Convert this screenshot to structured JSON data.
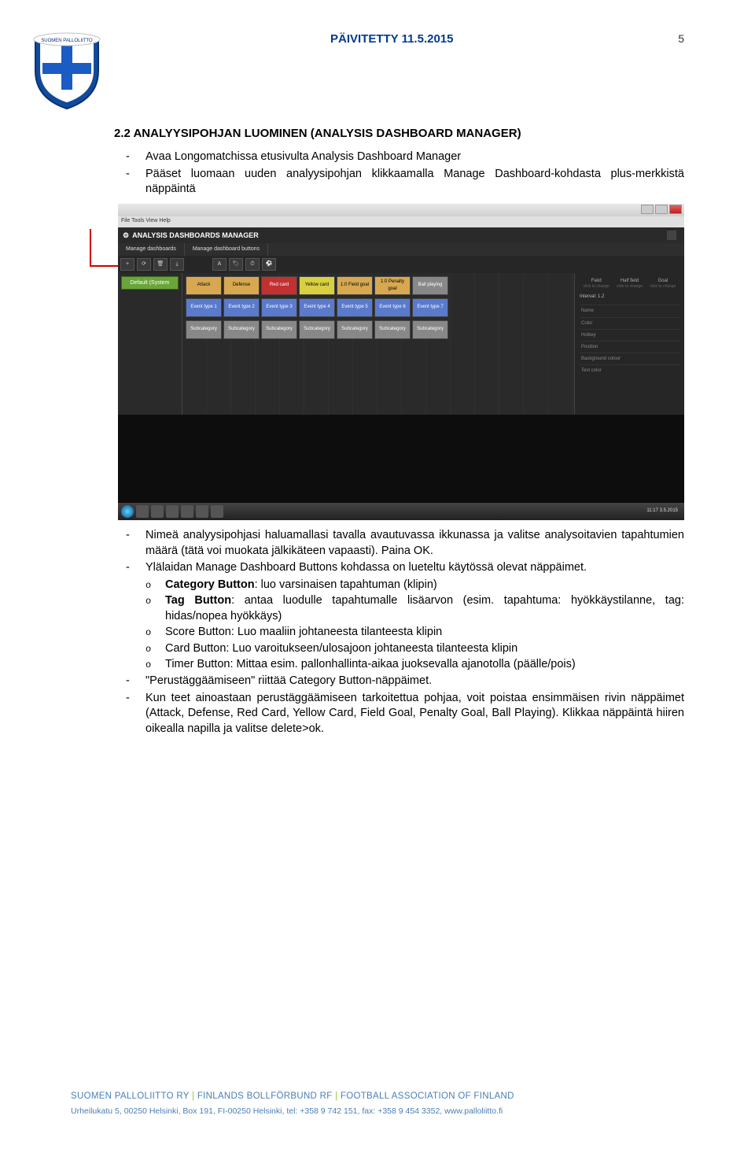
{
  "header": {
    "date": "PÄIVITETTY 11.5.2015",
    "page_number": "5",
    "logo_text": "SUOMEN PALLOLIITTO"
  },
  "section": {
    "title": "2.2 ANALYYSIPOHJAN LUOMINEN (ANALYSIS DASHBOARD MANAGER)",
    "top_bullets": [
      "Avaa Longomatchissa etusivulta Analysis Dashboard Manager",
      "Pääset luomaan uuden analyysipohjan klikkaamalla Manage Dashboard-kohdasta plus-merkkistä näppäintä"
    ],
    "bot_bullets": [
      "Nimeä analyysipohjasi haluamallasi tavalla avautuvassa ikkunassa ja valitse analysoitavien tapahtumien määrä (tätä voi muokata jälkikäteen vapaasti). Paina OK.",
      "Ylälaidan Manage Dashboard Buttons kohdassa on lueteltu käytössä olevat näppäimet."
    ],
    "sub_bullets": [
      {
        "bold": "Category Button",
        "rest": ": luo varsinaisen tapahtuman (klipin)"
      },
      {
        "bold": "Tag Button",
        "rest": ": antaa luodulle tapahtumalle lisäarvon (esim. tapahtuma: hyökkäystilanne, tag: hidas/nopea hyökkäys)"
      },
      {
        "bold": "",
        "rest": "Score Button: Luo maaliin johtaneesta tilanteesta klipin"
      },
      {
        "bold": "",
        "rest": "Card Button: Luo varoitukseen/ulosajoon johtaneesta tilanteesta klipin"
      },
      {
        "bold": "",
        "rest": "Timer Button: Mittaa esim. pallonhallinta-aikaa juoksevalla ajanotolla (päälle/pois)"
      }
    ],
    "bot_bullets2": [
      "\"Perustäggäämiseen\" riittää Category Button-näppäimet.",
      "Kun teet ainoastaan perustäggäämiseen tarkoitettua pohjaa, voit poistaa ensimmäisen rivin näppäimet (Attack, Defense, Red Card, Yellow Card, Field Goal, Penalty Goal, Ball Playing). Klikkaa näppäintä hiiren oikealla napilla ja valitse delete>ok."
    ]
  },
  "screenshot": {
    "menubar": "File  Tools  View  Help",
    "adm_title": "ANALYSIS DASHBOARDS MANAGER",
    "tabs": [
      "Manage dashboards",
      "Manage dashboard buttons"
    ],
    "default_btn": "Default (System",
    "row1": [
      "Attack",
      "Defense",
      "Red card",
      "Yellow card",
      "1:0 Field goal",
      "1:0 Penalty goal",
      "Ball playing"
    ],
    "row2": [
      "Event type 1",
      "Event type 2",
      "Event type 3",
      "Event type 4",
      "Event type 5",
      "Event type 6",
      "Event type 7"
    ],
    "row3": [
      "Subcategory",
      "Subcategory",
      "Subcategory",
      "Subcategory",
      "Subcategory",
      "Subcategory",
      "Subcategory"
    ],
    "side": {
      "field": "Field",
      "half": "Half field",
      "goal": "Goal",
      "click": "click to change",
      "interval": "Interval: 1.2"
    },
    "side_items": [
      "Name",
      "Color",
      "Hotkey",
      "Position",
      "Background colour",
      "Text color"
    ],
    "clock": "11:17\n3.5.2015"
  },
  "footer": {
    "org1": "SUOMEN PALLOLIITTO RY",
    "org2": "FINLANDS BOLLFÖRBUND RF",
    "org3": "FOOTBALL ASSOCIATION OF FINLAND",
    "contact": "Urheilukatu 5, 00250 Helsinki, Box 191, FI-00250 Helsinki, tel: +358 9 742 151, fax: +358 9 454 3352, www.palloliitto.fi"
  }
}
